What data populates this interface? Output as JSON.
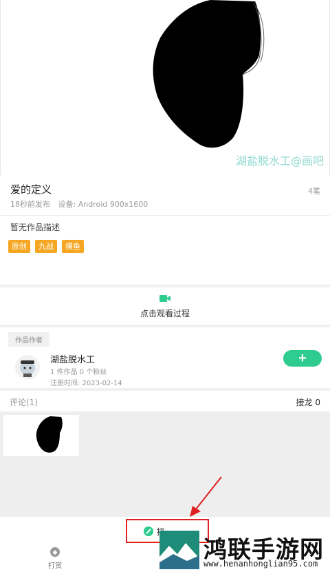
{
  "artwork": {
    "watermark": "湖盐脱水工@画吧"
  },
  "work": {
    "title": "爱的定义",
    "strokes": "4笔",
    "published": "18秒前发布",
    "device": "设备: Android  900x1600",
    "description": "暂无作品描述",
    "tags": [
      "原创",
      "九战",
      "摸鱼"
    ]
  },
  "watch": {
    "label": "点击观看过程",
    "icon": "video-camera-icon"
  },
  "author": {
    "section_label": "作品作者",
    "name": "湖盐脱水工",
    "stats": "1 件作品  0 个粉丝",
    "registered": "注册时间: 2023-02-14",
    "follow_label": "+"
  },
  "comments": {
    "label": "评论(1)",
    "relay": "接龙 0"
  },
  "bottom": {
    "tip_label": "打赏",
    "relay_button_label": "接龙"
  },
  "watermark_site": {
    "name": "鸿联手游网",
    "url": "www.henanhonglian95.com"
  },
  "colors": {
    "accent": "#2ecc8f",
    "tag": "#f5a623",
    "highlight": "#e02020",
    "watermark": "#8fd9cf"
  }
}
